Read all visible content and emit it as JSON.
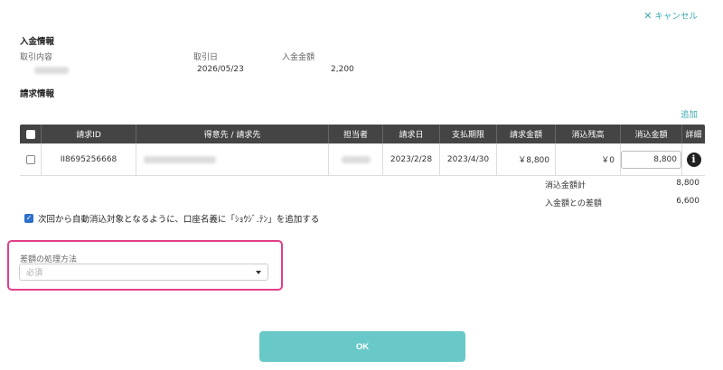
{
  "cancel": {
    "label": "キャンセル"
  },
  "payment": {
    "title": "入金情報",
    "col_transaction": "取引内容",
    "col_date": "取引日",
    "col_amount": "入金金額",
    "date": "2026/05/23",
    "amount": "2,200"
  },
  "billing": {
    "title": "請求情報",
    "add_label": "追加",
    "headers": [
      "請求ID",
      "得意先 / 請求先",
      "担当者",
      "請求日",
      "支払期限",
      "請求金額",
      "消込残高",
      "消込金額",
      "詳細"
    ],
    "rows": [
      {
        "id": "II8695256668",
        "invoice_date": "2023/2/28",
        "due_date": "2023/4/30",
        "amount": "￥8,800",
        "balance": "￥0",
        "clear_amount": "8,800"
      }
    ],
    "total_label": "消込金額計",
    "total_value": "8,800",
    "diff_label": "入金額との差額",
    "diff_value": "6,600"
  },
  "auto_clear": {
    "label": "次回から自動消込対象となるように、口座名義に「ｼｮｳｼﾞ.ﾃﾝ」を追加する",
    "checked": true
  },
  "diff_method": {
    "label": "差額の処理方法",
    "placeholder": "必須"
  },
  "ok_button": {
    "label": "OK"
  },
  "colors": {
    "accent": "#3aa9b0",
    "ok_button": "#69c9c8",
    "highlight": "#e0408a",
    "header_bg": "#444444"
  }
}
